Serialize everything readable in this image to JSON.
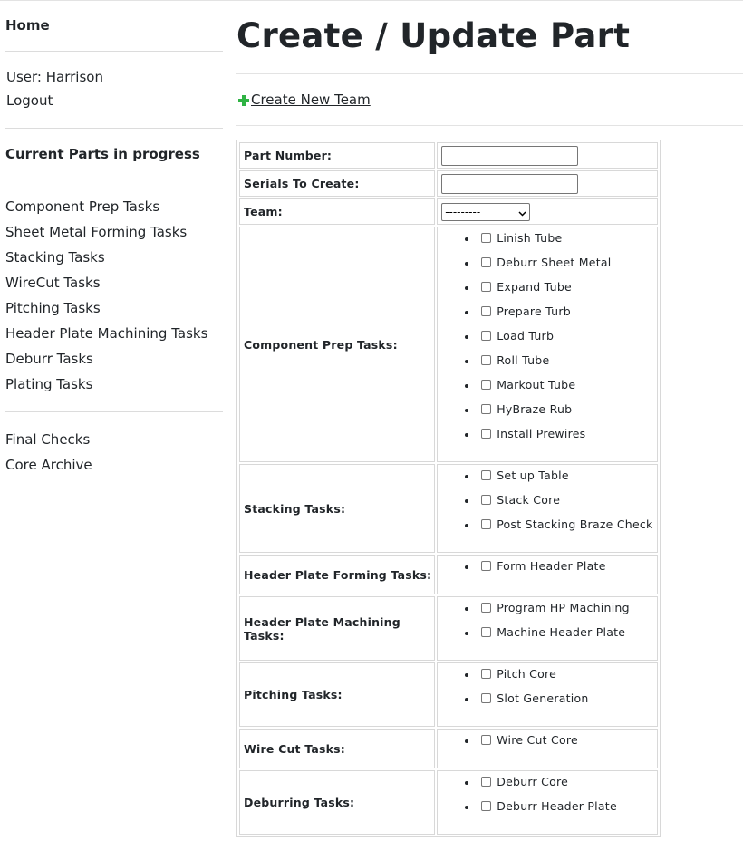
{
  "sidebar": {
    "home": "Home",
    "user": "User: Harrison",
    "logout": "Logout",
    "current_parts": "Current Parts in progress",
    "task_links": [
      "Component Prep Tasks",
      "Sheet Metal Forming Tasks",
      "Stacking Tasks",
      "WireCut Tasks",
      "Pitching Tasks",
      "Header Plate Machining Tasks",
      "Deburr Tasks",
      "Plating Tasks"
    ],
    "final_checks": "Final Checks",
    "core_archive": "Core Archive"
  },
  "main": {
    "title": "Create / Update Part",
    "create_team": "Create New Team"
  },
  "form": {
    "part_number_label": "Part Number:",
    "serials_label": "Serials To Create:",
    "team_label": "Team:",
    "team_selected": "---------",
    "component_prep_label": "Component Prep Tasks:",
    "component_prep_tasks": [
      "Linish Tube",
      "Deburr Sheet Metal",
      "Expand Tube",
      "Prepare Turb",
      "Load Turb",
      "Roll Tube",
      "Markout Tube",
      "HyBraze Rub",
      "Install Prewires"
    ],
    "stacking_label": "Stacking Tasks:",
    "stacking_tasks": [
      "Set up Table",
      "Stack Core",
      "Post Stacking Braze Check"
    ],
    "hp_forming_label": "Header Plate Forming Tasks:",
    "hp_forming_tasks": [
      "Form Header Plate"
    ],
    "hp_machining_label": "Header Plate Machining Tasks:",
    "hp_machining_tasks": [
      "Program HP Machining",
      "Machine Header Plate"
    ],
    "pitching_label": "Pitching Tasks:",
    "pitching_tasks": [
      "Pitch Core",
      "Slot Generation"
    ],
    "wirecut_label": "Wire Cut Tasks:",
    "wirecut_tasks": [
      "Wire Cut Core"
    ],
    "deburring_label": "Deburring Tasks:",
    "deburring_tasks": [
      "Deburr Core",
      "Deburr Header Plate"
    ]
  },
  "colors": {
    "text": "#212529",
    "border": "#d8d8d8",
    "plus_icon": "#2fb344"
  }
}
